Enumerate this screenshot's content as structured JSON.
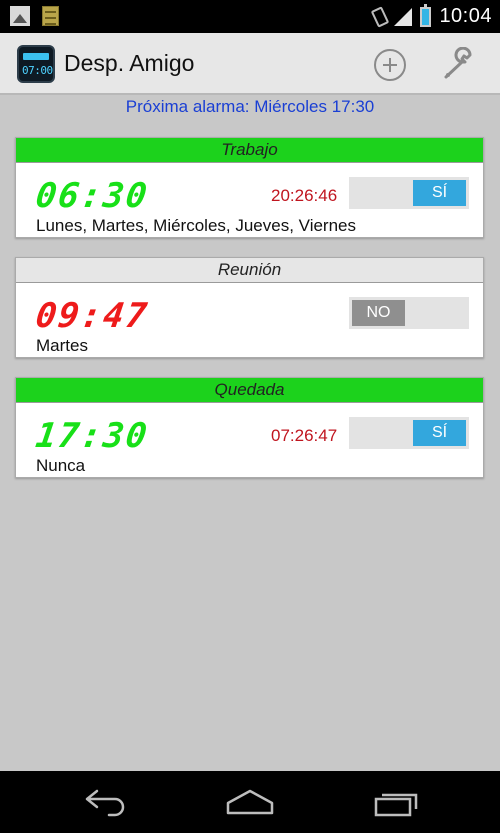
{
  "status_bar": {
    "left_icons": [
      "picture-icon",
      "notes-icon"
    ],
    "right_icons": [
      "vibrate-icon",
      "signal-icon",
      "battery-icon"
    ],
    "time": "10:04"
  },
  "action_bar": {
    "app_icon_text": "07:00",
    "title": "Desp. Amigo",
    "add_icon": "add-circle-icon",
    "settings_icon": "wrench-icon"
  },
  "next_alarm": "Próxima alarma:  Miércoles 17:30",
  "alarms": [
    {
      "title": "Trabajo",
      "time": "06:30",
      "remaining": "20:26:46",
      "toggle": "SÍ",
      "enabled": true,
      "days": "Lunes, Martes, Miércoles, Jueves, Viernes"
    },
    {
      "title": "Reunión",
      "time": "09:47",
      "remaining": "",
      "toggle": "NO",
      "enabled": false,
      "days": "Martes"
    },
    {
      "title": "Quedada",
      "time": "17:30",
      "remaining": "07:26:47",
      "toggle": "SÍ",
      "enabled": true,
      "days": "Nunca"
    }
  ],
  "colors": {
    "enabled_header": "#1cd21c",
    "disabled_header": "#e6e6e6",
    "enabled_time": "#18e018",
    "disabled_time": "#ee1b1b",
    "remaining_text": "#c0151f",
    "toggle_on": "#33a7dd",
    "next_alarm_text": "#1a3fd4"
  },
  "nav_bar": {
    "back_icon": "back-icon",
    "home_icon": "home-icon",
    "recents_icon": "recent-apps-icon"
  }
}
